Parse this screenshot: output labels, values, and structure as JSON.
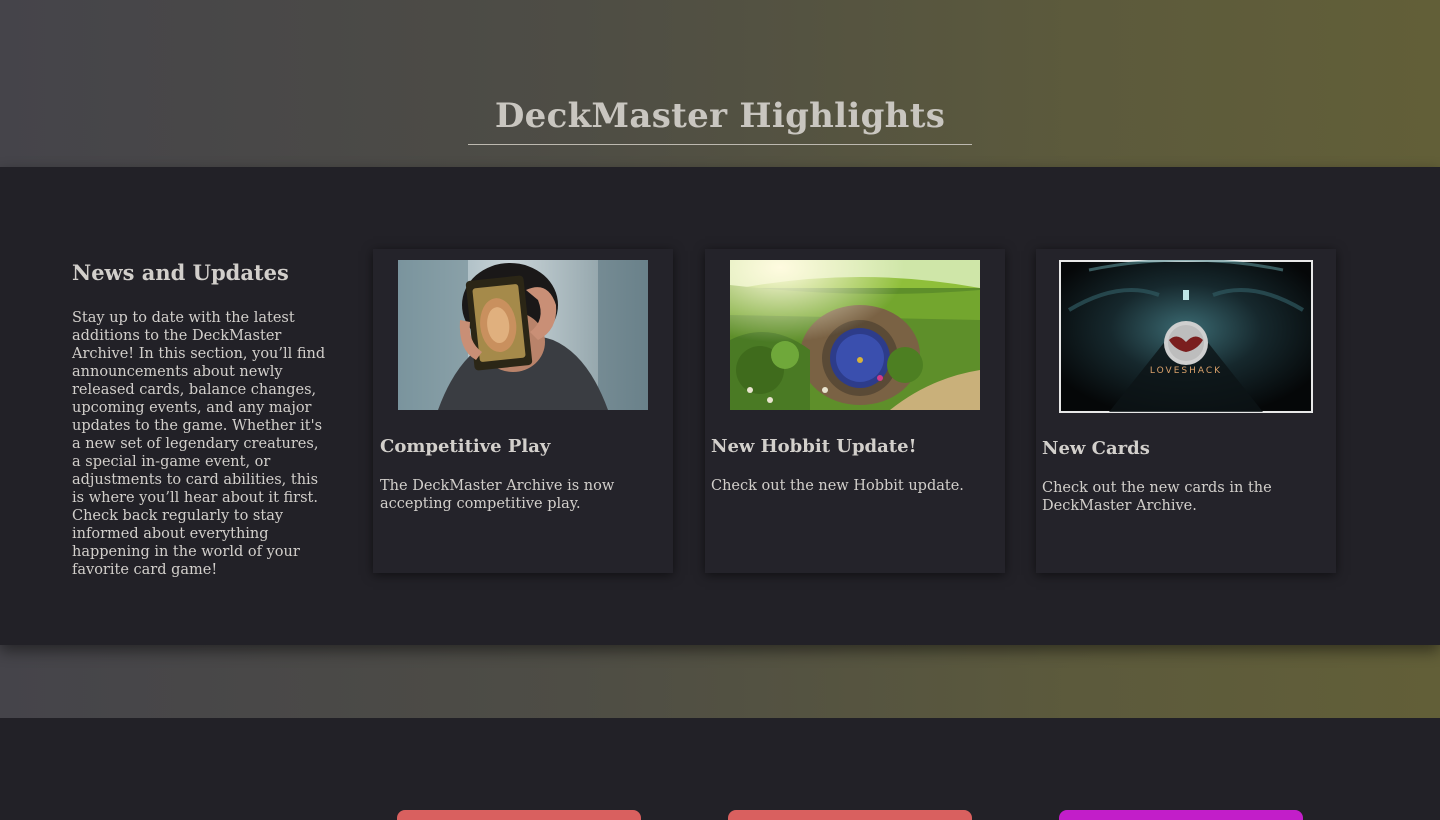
{
  "hero": {
    "title": "DeckMaster Highlights"
  },
  "intro": {
    "heading": "News and Updates",
    "body": "Stay up to date with the latest additions to the DeckMaster Archive! In this section, you’ll find announcements about newly released cards, balance changes, upcoming events, and any major updates to the game. Whether it's a new set of legendary creatures, a special in-game event, or adjustments to card abilities, this is where you’ll hear about it first. Check back regularly to stay informed about everything happening in the world of your favorite card game!"
  },
  "cards": [
    {
      "title": "Competitive Play",
      "text": "The DeckMaster Archive is now accepting competitive play.",
      "image": "person-holding-card-photo"
    },
    {
      "title": "New Hobbit Update!",
      "text": "Check out the new Hobbit update.",
      "image": "hobbit-hole-photo"
    },
    {
      "title": "New Cards",
      "text": "Check out the new cards in the DeckMaster Archive.",
      "image": "loveshack-logo-image",
      "image_caption": "LOVESHACK"
    }
  ],
  "colors": {
    "background": "#222127",
    "band_gradient_start": "#45444a",
    "band_gradient_end": "#625f38",
    "button_red": "#d9605f",
    "button_magenta": "#c21ec9"
  }
}
